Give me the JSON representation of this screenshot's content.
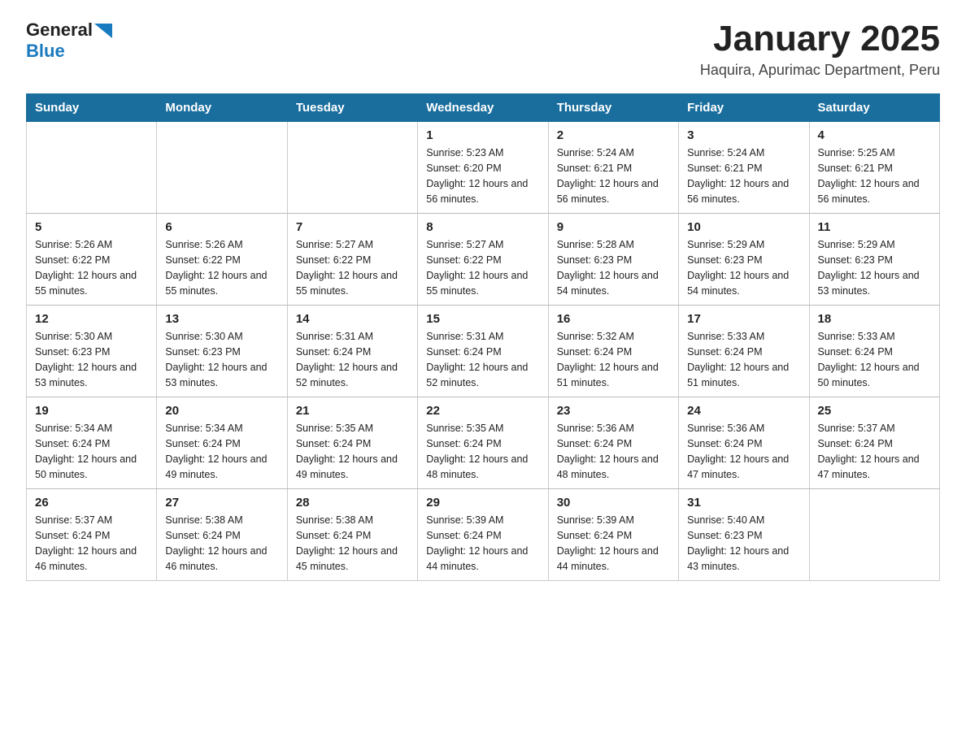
{
  "header": {
    "logo_general": "General",
    "logo_blue": "Blue",
    "main_title": "January 2025",
    "subtitle": "Haquira, Apurimac Department, Peru"
  },
  "days_of_week": [
    "Sunday",
    "Monday",
    "Tuesday",
    "Wednesday",
    "Thursday",
    "Friday",
    "Saturday"
  ],
  "weeks": [
    [
      {
        "day": "",
        "detail": ""
      },
      {
        "day": "",
        "detail": ""
      },
      {
        "day": "",
        "detail": ""
      },
      {
        "day": "1",
        "detail": "Sunrise: 5:23 AM\nSunset: 6:20 PM\nDaylight: 12 hours\nand 56 minutes."
      },
      {
        "day": "2",
        "detail": "Sunrise: 5:24 AM\nSunset: 6:21 PM\nDaylight: 12 hours\nand 56 minutes."
      },
      {
        "day": "3",
        "detail": "Sunrise: 5:24 AM\nSunset: 6:21 PM\nDaylight: 12 hours\nand 56 minutes."
      },
      {
        "day": "4",
        "detail": "Sunrise: 5:25 AM\nSunset: 6:21 PM\nDaylight: 12 hours\nand 56 minutes."
      }
    ],
    [
      {
        "day": "5",
        "detail": "Sunrise: 5:26 AM\nSunset: 6:22 PM\nDaylight: 12 hours\nand 55 minutes."
      },
      {
        "day": "6",
        "detail": "Sunrise: 5:26 AM\nSunset: 6:22 PM\nDaylight: 12 hours\nand 55 minutes."
      },
      {
        "day": "7",
        "detail": "Sunrise: 5:27 AM\nSunset: 6:22 PM\nDaylight: 12 hours\nand 55 minutes."
      },
      {
        "day": "8",
        "detail": "Sunrise: 5:27 AM\nSunset: 6:22 PM\nDaylight: 12 hours\nand 55 minutes."
      },
      {
        "day": "9",
        "detail": "Sunrise: 5:28 AM\nSunset: 6:23 PM\nDaylight: 12 hours\nand 54 minutes."
      },
      {
        "day": "10",
        "detail": "Sunrise: 5:29 AM\nSunset: 6:23 PM\nDaylight: 12 hours\nand 54 minutes."
      },
      {
        "day": "11",
        "detail": "Sunrise: 5:29 AM\nSunset: 6:23 PM\nDaylight: 12 hours\nand 53 minutes."
      }
    ],
    [
      {
        "day": "12",
        "detail": "Sunrise: 5:30 AM\nSunset: 6:23 PM\nDaylight: 12 hours\nand 53 minutes."
      },
      {
        "day": "13",
        "detail": "Sunrise: 5:30 AM\nSunset: 6:23 PM\nDaylight: 12 hours\nand 53 minutes."
      },
      {
        "day": "14",
        "detail": "Sunrise: 5:31 AM\nSunset: 6:24 PM\nDaylight: 12 hours\nand 52 minutes."
      },
      {
        "day": "15",
        "detail": "Sunrise: 5:31 AM\nSunset: 6:24 PM\nDaylight: 12 hours\nand 52 minutes."
      },
      {
        "day": "16",
        "detail": "Sunrise: 5:32 AM\nSunset: 6:24 PM\nDaylight: 12 hours\nand 51 minutes."
      },
      {
        "day": "17",
        "detail": "Sunrise: 5:33 AM\nSunset: 6:24 PM\nDaylight: 12 hours\nand 51 minutes."
      },
      {
        "day": "18",
        "detail": "Sunrise: 5:33 AM\nSunset: 6:24 PM\nDaylight: 12 hours\nand 50 minutes."
      }
    ],
    [
      {
        "day": "19",
        "detail": "Sunrise: 5:34 AM\nSunset: 6:24 PM\nDaylight: 12 hours\nand 50 minutes."
      },
      {
        "day": "20",
        "detail": "Sunrise: 5:34 AM\nSunset: 6:24 PM\nDaylight: 12 hours\nand 49 minutes."
      },
      {
        "day": "21",
        "detail": "Sunrise: 5:35 AM\nSunset: 6:24 PM\nDaylight: 12 hours\nand 49 minutes."
      },
      {
        "day": "22",
        "detail": "Sunrise: 5:35 AM\nSunset: 6:24 PM\nDaylight: 12 hours\nand 48 minutes."
      },
      {
        "day": "23",
        "detail": "Sunrise: 5:36 AM\nSunset: 6:24 PM\nDaylight: 12 hours\nand 48 minutes."
      },
      {
        "day": "24",
        "detail": "Sunrise: 5:36 AM\nSunset: 6:24 PM\nDaylight: 12 hours\nand 47 minutes."
      },
      {
        "day": "25",
        "detail": "Sunrise: 5:37 AM\nSunset: 6:24 PM\nDaylight: 12 hours\nand 47 minutes."
      }
    ],
    [
      {
        "day": "26",
        "detail": "Sunrise: 5:37 AM\nSunset: 6:24 PM\nDaylight: 12 hours\nand 46 minutes."
      },
      {
        "day": "27",
        "detail": "Sunrise: 5:38 AM\nSunset: 6:24 PM\nDaylight: 12 hours\nand 46 minutes."
      },
      {
        "day": "28",
        "detail": "Sunrise: 5:38 AM\nSunset: 6:24 PM\nDaylight: 12 hours\nand 45 minutes."
      },
      {
        "day": "29",
        "detail": "Sunrise: 5:39 AM\nSunset: 6:24 PM\nDaylight: 12 hours\nand 44 minutes."
      },
      {
        "day": "30",
        "detail": "Sunrise: 5:39 AM\nSunset: 6:24 PM\nDaylight: 12 hours\nand 44 minutes."
      },
      {
        "day": "31",
        "detail": "Sunrise: 5:40 AM\nSunset: 6:23 PM\nDaylight: 12 hours\nand 43 minutes."
      },
      {
        "day": "",
        "detail": ""
      }
    ]
  ]
}
